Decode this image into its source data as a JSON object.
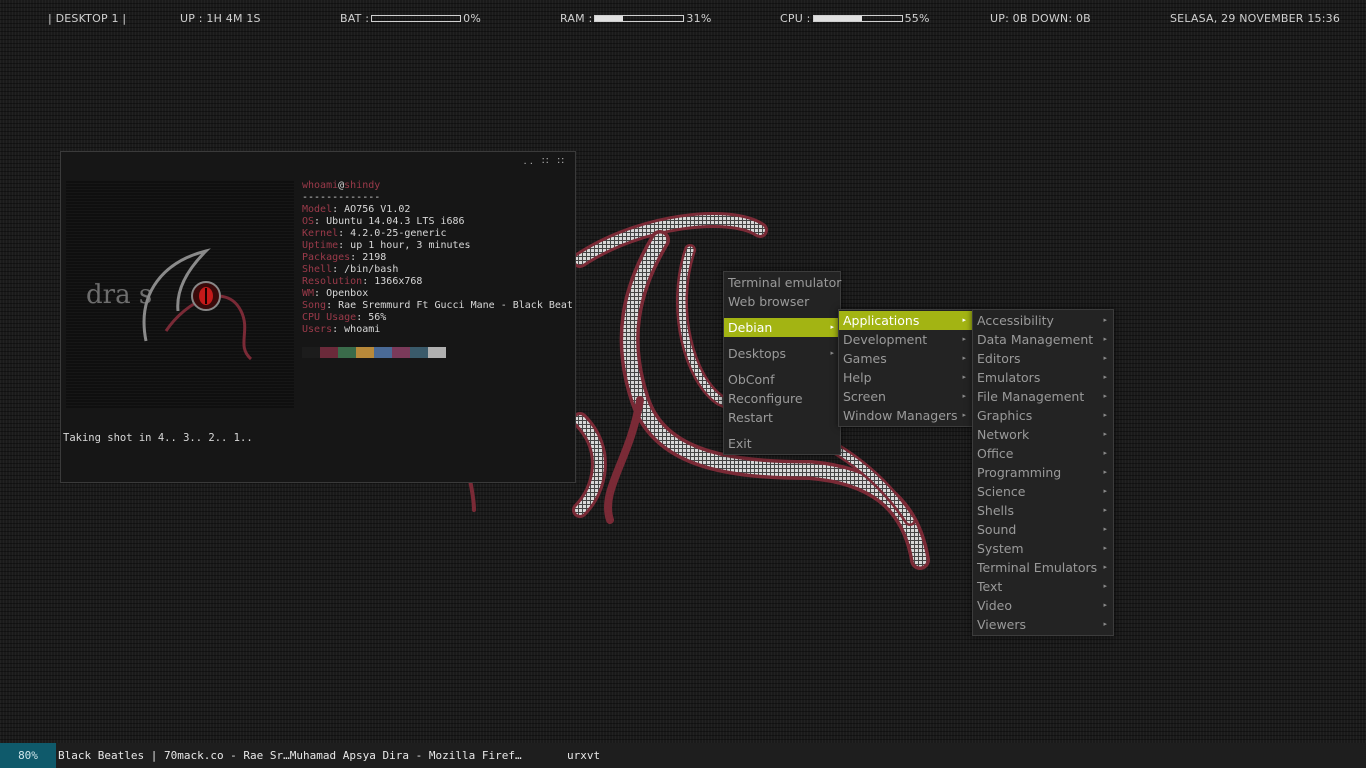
{
  "topbar": {
    "desktop": "|  DESKTOP 1  |",
    "uptime": "UP : 1H 4M 1S",
    "bat_label": "BAT :",
    "bat_value": "0%",
    "bat_fraction": 0,
    "ram_label": "RAM :",
    "ram_value": "31%",
    "ram_fraction": 0.31,
    "cpu_label": "CPU :",
    "cpu_value": "55%",
    "cpu_fraction": 0.55,
    "net": "UP: 0B   DOWN: 0B",
    "datetime": "SELASA, 29 NOVEMBER 15:36"
  },
  "terminal": {
    "buttons": ".. ∷ ∷",
    "logo_text": "dra  s",
    "prompt_user": "whoami",
    "prompt_at": "@",
    "prompt_host": "shindy",
    "underline": "-------------",
    "info": [
      {
        "key": "Model",
        "value": "AO756 V1.02"
      },
      {
        "key": "OS",
        "value": "Ubuntu 14.04.3 LTS i686"
      },
      {
        "key": "Kernel",
        "value": "4.2.0-25-generic"
      },
      {
        "key": "Uptime",
        "value": "up 1 hour, 3 minutes"
      },
      {
        "key": "Packages",
        "value": "2198"
      },
      {
        "key": "Shell",
        "value": "/bin/bash"
      },
      {
        "key": "Resolution",
        "value": "1366x768"
      },
      {
        "key": "WM",
        "value": "Openbox"
      },
      {
        "key": "Song",
        "value": "Rae Sremmurd Ft Gucci Mane - Black Beat"
      },
      {
        "key": "CPU Usage",
        "value": "56%"
      },
      {
        "key": "Users",
        "value": "whoami"
      }
    ],
    "palette": [
      "#1c1c1c",
      "#6b2a3a",
      "#3a6b4a",
      "#b8893a",
      "#4a6a96",
      "#7a3a5a",
      "#3a5a6a",
      "#b0b0b0"
    ],
    "shot_line": "Taking shot in 4.. 3.. 2.. 1.."
  },
  "root_menu": {
    "items": [
      {
        "label": "Terminal emulator",
        "submenu": false
      },
      {
        "label": "Web browser",
        "submenu": false
      },
      {
        "sep": true
      },
      {
        "label": "Debian",
        "submenu": true,
        "active": true
      },
      {
        "sep": true
      },
      {
        "label": "Desktops",
        "submenu": true
      },
      {
        "sep": true
      },
      {
        "label": "ObConf",
        "submenu": false
      },
      {
        "label": "Reconfigure",
        "submenu": false
      },
      {
        "label": "Restart",
        "submenu": false
      },
      {
        "sep": true
      },
      {
        "label": "Exit",
        "submenu": false
      }
    ]
  },
  "debian_menu": {
    "items": [
      {
        "label": "Applications",
        "submenu": true,
        "active": true
      },
      {
        "label": "Development",
        "submenu": true
      },
      {
        "label": "Games",
        "submenu": true
      },
      {
        "label": "Help",
        "submenu": true
      },
      {
        "label": "Screen",
        "submenu": true
      },
      {
        "label": "Window Managers",
        "submenu": true
      }
    ]
  },
  "apps_menu": {
    "items": [
      {
        "label": "Accessibility",
        "submenu": true
      },
      {
        "label": "Data Management",
        "submenu": true
      },
      {
        "label": "Editors",
        "submenu": true
      },
      {
        "label": "Emulators",
        "submenu": true
      },
      {
        "label": "File Management",
        "submenu": true
      },
      {
        "label": "Graphics",
        "submenu": true
      },
      {
        "label": "Network",
        "submenu": true
      },
      {
        "label": "Office",
        "submenu": true
      },
      {
        "label": "Programming",
        "submenu": true
      },
      {
        "label": "Science",
        "submenu": true
      },
      {
        "label": "Shells",
        "submenu": true
      },
      {
        "label": "Sound",
        "submenu": true
      },
      {
        "label": "System",
        "submenu": true
      },
      {
        "label": "Terminal Emulators",
        "submenu": true
      },
      {
        "label": "Text",
        "submenu": true
      },
      {
        "label": "Video",
        "submenu": true
      },
      {
        "label": "Viewers",
        "submenu": true
      }
    ]
  },
  "bottombar": {
    "battery": "80%",
    "tasks": [
      {
        "label": "Black Beatles | 70mack.co - Rae Sr…Muhamad Apsya Dira - Mozilla Firef…"
      },
      {
        "label": "urxvt"
      }
    ]
  },
  "colors": {
    "menu_active": "#a3b413",
    "accent_red": "#9b3a4a",
    "battery_bg": "#0f5a6b"
  }
}
